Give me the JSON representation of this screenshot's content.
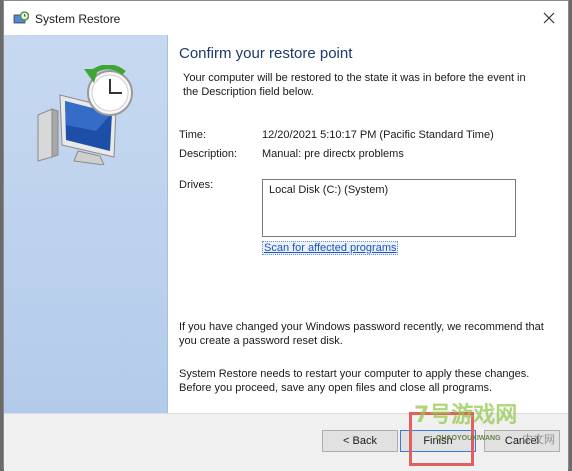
{
  "window": {
    "title": "System Restore"
  },
  "icons": {
    "app": "system-restore-icon",
    "close": "close-icon",
    "illustration": "restore-monitor-clock-icon"
  },
  "main": {
    "heading": "Confirm your restore point",
    "intro": "Your computer will be restored to the state it was in before the event in the Description field below.",
    "time_label": "Time:",
    "time_value": "12/20/2021 5:10:17 PM (Pacific Standard Time)",
    "description_label": "Description:",
    "description_value": "Manual: pre directx problems",
    "drives_label": "Drives:",
    "drives": [
      "Local Disk (C:) (System)"
    ],
    "scan_link": "Scan for affected programs",
    "password_note": "If you have changed your Windows password recently, we recommend that you create a password reset disk.",
    "restart_note": "System Restore needs to restart your computer to apply these changes. Before you proceed, save any open files and close all programs."
  },
  "footer": {
    "back_label": "< Back",
    "finish_label": "Finish",
    "cancel_label": "Cancel"
  },
  "watermark": {
    "brand": "7号游戏网",
    "url": "QHAOYOUXIWANG",
    "right": "中文网"
  },
  "colors": {
    "heading": "#1b3a6b",
    "link": "#1a56b8",
    "panel": "#c7d9f1",
    "focus": "#3b78d8"
  }
}
